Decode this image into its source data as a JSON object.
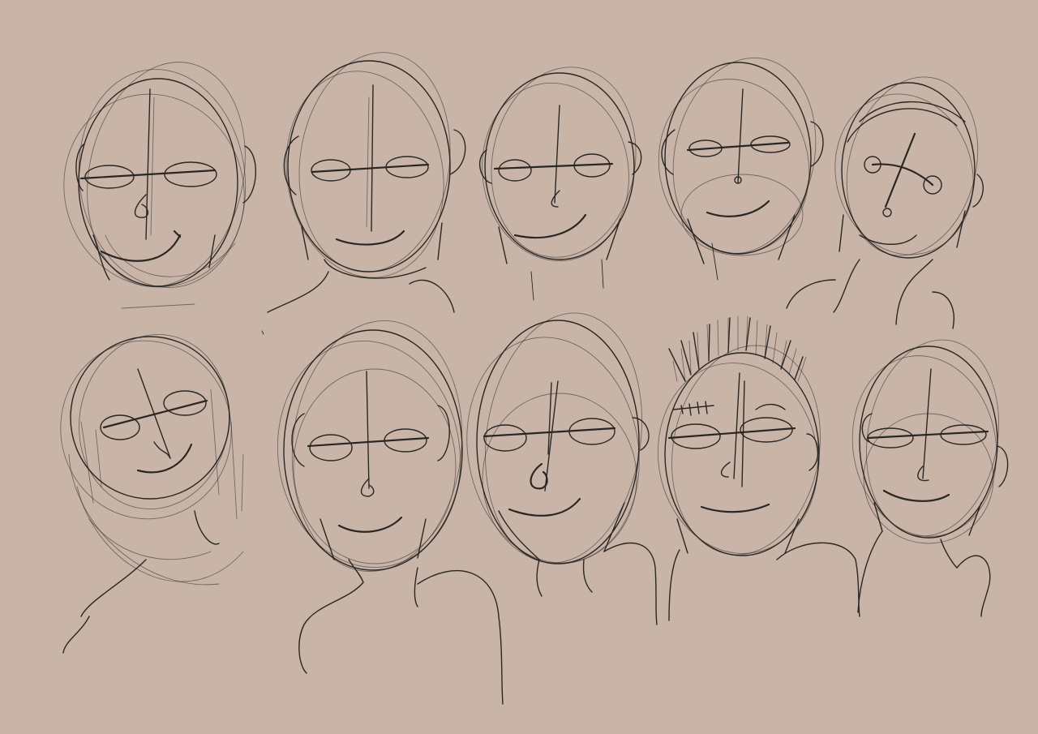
{
  "canvas": {
    "background": "#c9b5a8",
    "ink": "#2a2624",
    "subject": "sketch-sheet"
  },
  "rows": [
    {
      "row": 1,
      "face_count": 5
    },
    {
      "row": 2,
      "face_count": 5
    }
  ],
  "faces": [
    {
      "id": "face-1",
      "row": 1,
      "has_glasses": true,
      "has_ear_right": true,
      "has_shoulders": false
    },
    {
      "id": "face-2",
      "row": 1,
      "has_glasses": true,
      "has_ear_right": true,
      "has_shoulders": true
    },
    {
      "id": "face-3",
      "row": 1,
      "has_glasses": true,
      "has_ear_right": true,
      "has_shoulders": false
    },
    {
      "id": "face-4",
      "row": 1,
      "has_glasses": true,
      "has_ear_right": true,
      "has_shoulders": false
    },
    {
      "id": "face-5",
      "row": 1,
      "has_glasses": true,
      "has_ear_right": true,
      "has_shoulders": true
    },
    {
      "id": "face-6",
      "row": 2,
      "has_glasses": true,
      "has_ear_right": false,
      "has_shoulders": true
    },
    {
      "id": "face-7",
      "row": 2,
      "has_glasses": true,
      "has_ear_right": true,
      "has_shoulders": true
    },
    {
      "id": "face-8",
      "row": 2,
      "has_glasses": true,
      "has_ear_right": true,
      "has_shoulders": true
    },
    {
      "id": "face-9",
      "row": 2,
      "has_glasses": true,
      "has_ear_right": true,
      "has_shoulders": true
    },
    {
      "id": "face-10",
      "row": 2,
      "has_glasses": true,
      "has_ear_right": true,
      "has_shoulders": true
    }
  ]
}
